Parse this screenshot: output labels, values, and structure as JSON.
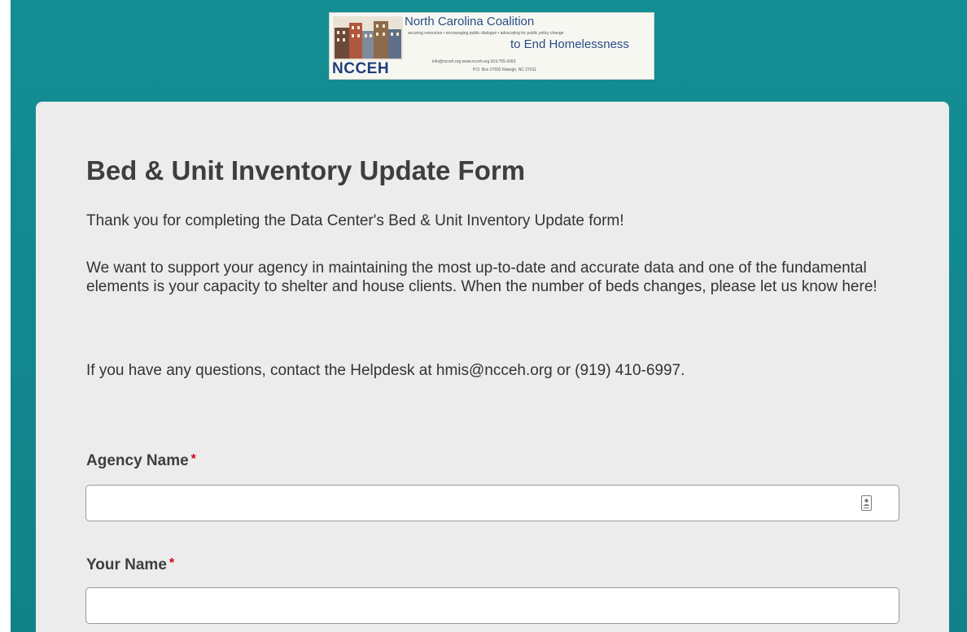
{
  "logo": {
    "org_line1": "North Carolina Coalition",
    "tagline": "securing resources • encouraging public dialogue • advocating for public policy change",
    "org_line2": "to End Homelessness",
    "acronym": "NCCEH",
    "contact": "info@ncceh.org     www.ncceh.org     919.755.4393",
    "address": "P.O. Box 27692 Raleigh, NC 27611"
  },
  "form": {
    "title": "Bed & Unit Inventory Update Form",
    "intro": [
      "Thank you for completing the Data Center's Bed & Unit Inventory Update form!",
      "We want to support your agency in maintaining the most up-to-date and accurate data and one of the fundamental elements is your capacity to shelter and house clients. When the number of beds changes, please let us know here!",
      "If you have any questions, contact the Helpdesk at hmis@ncceh.org or (919) 410-6997."
    ],
    "fields": [
      {
        "label": "Agency Name",
        "required_marker": "*",
        "value": "",
        "icon": "contact-card-icon"
      },
      {
        "label": "Your Name",
        "required_marker": "*",
        "value": ""
      }
    ]
  },
  "colors": {
    "background": "#12898f",
    "card": "#ececec",
    "heading": "#3e3e3e",
    "required": "#d0021b"
  }
}
